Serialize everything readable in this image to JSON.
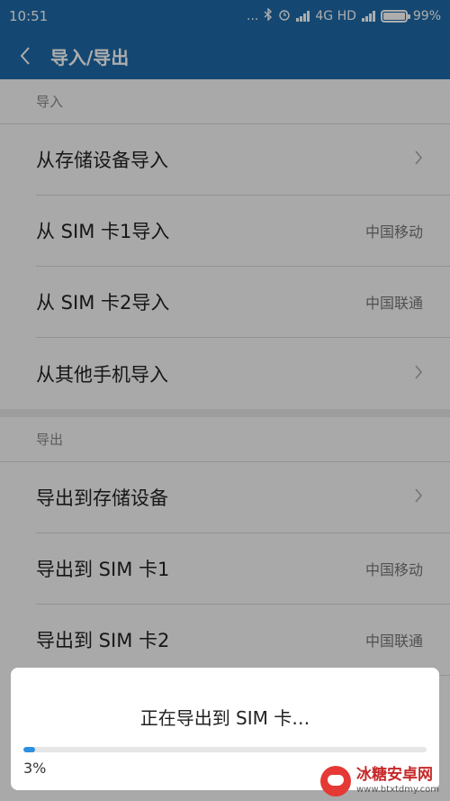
{
  "status_bar": {
    "time": "10:51",
    "dots": "...",
    "network": "4G HD",
    "battery_pct": "99%",
    "battery_level": 0.99
  },
  "header": {
    "title": "导入/导出"
  },
  "import_section": {
    "header": "导入",
    "items": [
      {
        "label": "从存储设备导入",
        "value": ""
      },
      {
        "label": "从 SIM 卡1导入",
        "value": "中国移动"
      },
      {
        "label": "从 SIM 卡2导入",
        "value": "中国联通"
      },
      {
        "label": "从其他手机导入",
        "value": ""
      }
    ]
  },
  "export_section": {
    "header": "导出",
    "items": [
      {
        "label": "导出到存储设备",
        "value": ""
      },
      {
        "label": "导出到 SIM 卡1",
        "value": "中国移动"
      },
      {
        "label": "导出到 SIM 卡2",
        "value": "中国联通"
      }
    ]
  },
  "dialog": {
    "message": "正在导出到 SIM 卡…",
    "progress_label": "3%",
    "progress": 0.03
  },
  "watermark": {
    "title": "冰糖安卓网",
    "url": "www.btxtdmy.com"
  },
  "colors": {
    "accent": "#1e6aa8",
    "progress": "#2c8fe0"
  }
}
